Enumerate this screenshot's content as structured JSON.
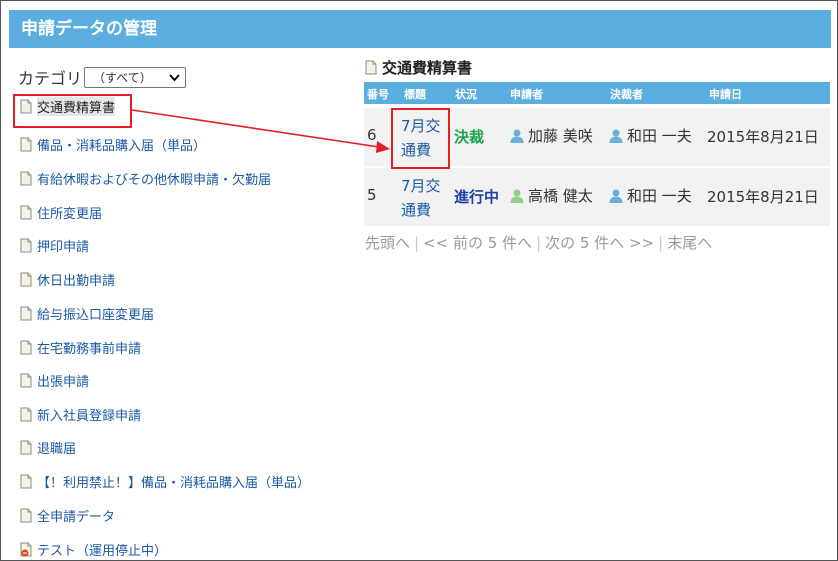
{
  "header": {
    "title": "申請データの管理"
  },
  "category": {
    "label": "カテゴリ",
    "selected": "（すべて）"
  },
  "forms": [
    {
      "label": "交通費精算書",
      "icon": "document-icon",
      "selected": true
    },
    {
      "label": "備品・消耗品購入届（単品）",
      "icon": "document-icon"
    },
    {
      "label": "有給休暇およびその他休暇申請・欠勤届",
      "icon": "document-icon"
    },
    {
      "label": "住所変更届",
      "icon": "document-icon"
    },
    {
      "label": "押印申請",
      "icon": "document-icon"
    },
    {
      "label": "休日出勤申請",
      "icon": "document-icon"
    },
    {
      "label": "給与振込口座変更届",
      "icon": "document-icon"
    },
    {
      "label": "在宅勤務事前申請",
      "icon": "document-icon"
    },
    {
      "label": "出張申請",
      "icon": "document-icon"
    },
    {
      "label": "新入社員登録申請",
      "icon": "document-icon"
    },
    {
      "label": "退職届",
      "icon": "document-icon"
    },
    {
      "label": "【！利用禁止！】備品・消耗品購入届（単品）",
      "icon": "document-icon"
    },
    {
      "label": "全申請データ",
      "icon": "document-icon"
    },
    {
      "label": "テスト（運用停止中）",
      "icon": "document-stopped-icon"
    }
  ],
  "detail": {
    "title": "交通費精算書",
    "columns": [
      "番号",
      "標題",
      "状況",
      "申請者",
      "決裁者",
      "申請日"
    ],
    "rows": [
      {
        "number": "6",
        "subject_line1": "7月交",
        "subject_line2": "通費",
        "status": "決裁",
        "applicant": "加藤 美咲",
        "approver": "和田 一夫",
        "date": "2015年8月21日"
      },
      {
        "number": "5",
        "subject_line1": "7月交",
        "subject_line2": "通費",
        "status": "進行中",
        "applicant": "高橋 健太",
        "approver": "和田 一夫",
        "date": "2015年8月21日"
      }
    ]
  },
  "pager": {
    "first": "先頭へ",
    "prev": "<< 前の 5 件へ",
    "next": "次の 5 件へ >>",
    "last": "末尾へ",
    "separator": "|"
  },
  "colors": {
    "header_bg": "#5aaee0",
    "link": "#1a5aa8",
    "status_done": "#1aa34a",
    "status_progress": "#1a3fa8",
    "highlight": "#e21f26"
  }
}
